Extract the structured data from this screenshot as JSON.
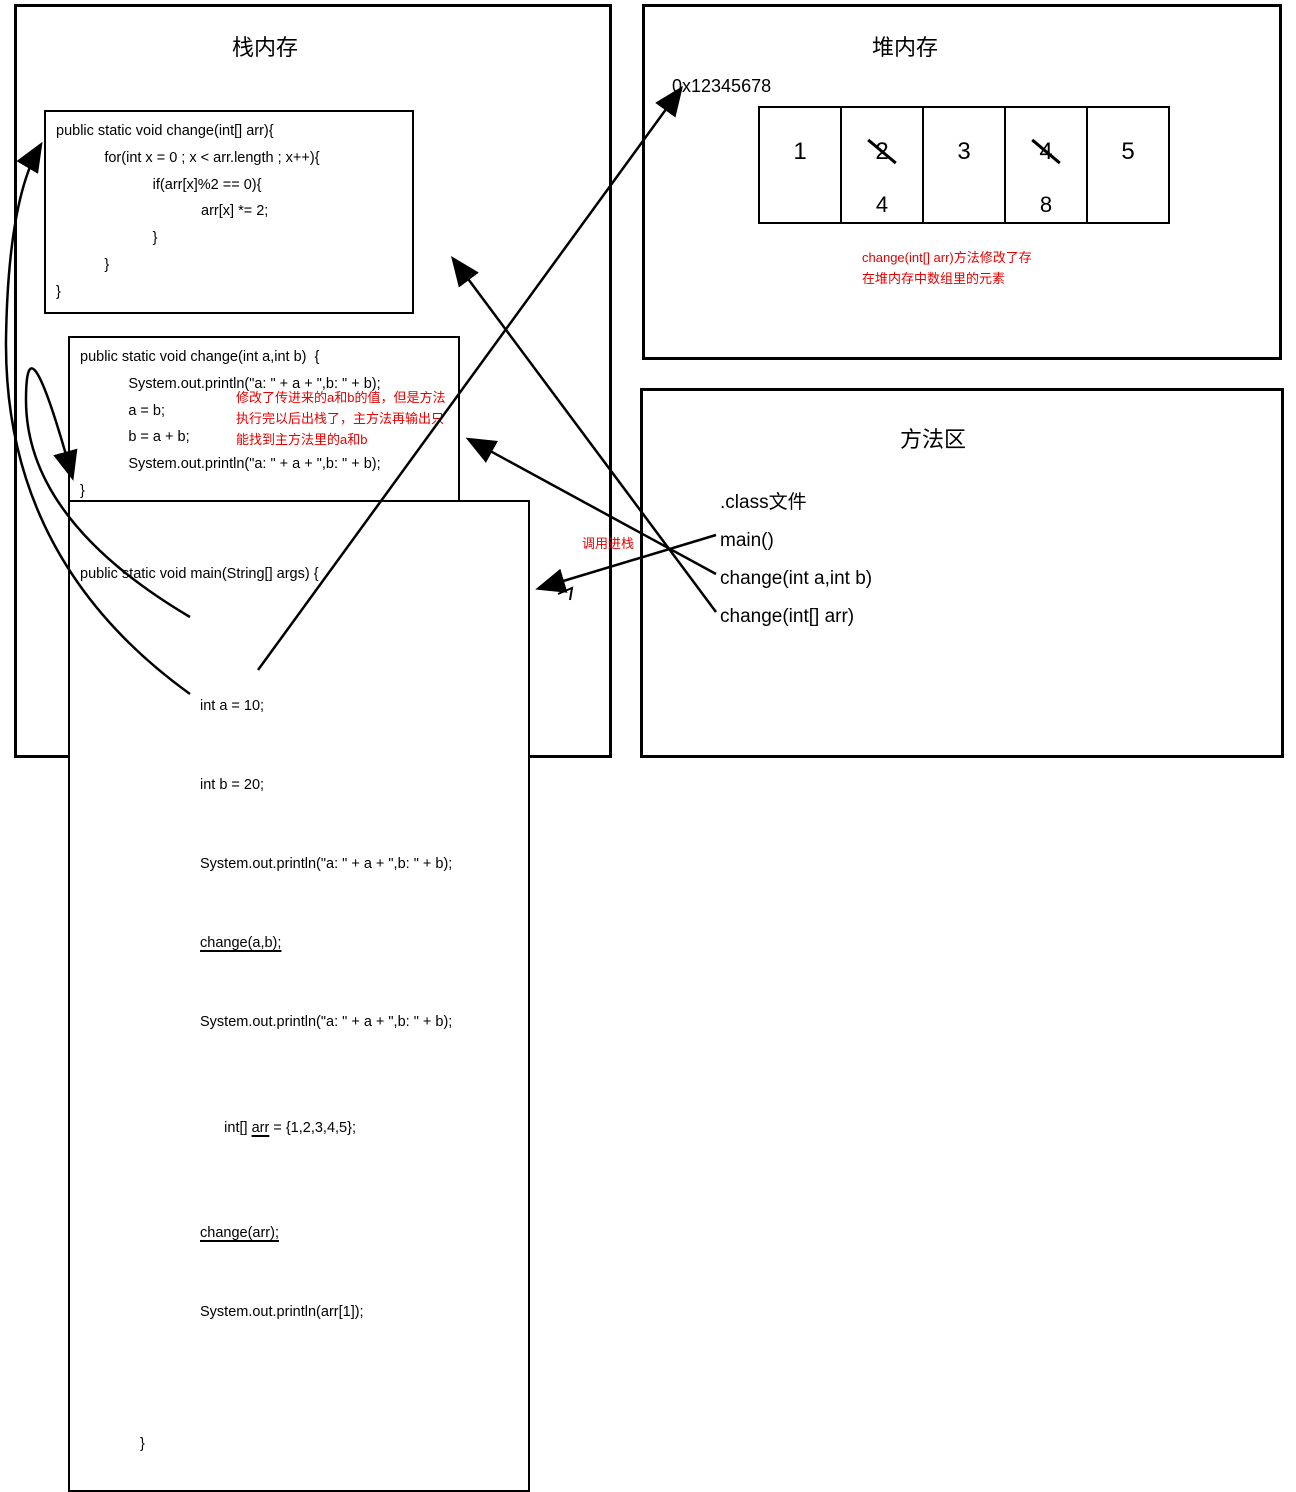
{
  "stack": {
    "title": "栈内存",
    "code1": "public static void change(int[] arr){\n            for(int x = 0 ; x < arr.length ; x++){\n                        if(arr[x]%2 == 0){\n                                    arr[x] *= 2;\n                        }\n            }\n}",
    "code2": "public static void change(int a,int b)  {\n            System.out.println(\"a: \" + a + \",b: \" + b);\n            a = b;\n            b = a + b;\n            System.out.println(\"a: \" + a + \",b: \" + b);\n}",
    "code3_sig": "public static void main(String[] args) {",
    "code3_l1": "int a = 10;",
    "code3_l2": "int b = 20;",
    "code3_l3": "System.out.println(\"a: \" + a + \",b: \" + b);",
    "code3_l4": "change(a,b);",
    "code3_l5": "System.out.println(\"a: \" + a + \",b: \" + b);",
    "code3_l6_pre": "int[] ",
    "code3_l6_u": "arr",
    "code3_l6_post": " = {1,2,3,4,5};",
    "code3_l7": "change(arr);",
    "code3_l8": "System.out.println(arr[1]);",
    "code3_close": "}",
    "note2": "修改了传进来的a和b的值，但是方法执行完以后出栈了，主方法再输出只能找到主方法里的a和b"
  },
  "heap": {
    "title": "堆内存",
    "addr": "0x12345678",
    "cells": [
      {
        "old": "1",
        "struck": false
      },
      {
        "old": "2",
        "struck": true,
        "new": "4"
      },
      {
        "old": "3",
        "struck": false
      },
      {
        "old": "4",
        "struck": true,
        "new": "8"
      },
      {
        "old": "5",
        "struck": false
      }
    ],
    "note": "change(int[] arr)方法修改了存在堆内存中数组里的元素"
  },
  "method_area": {
    "title": "方法区",
    "items": [
      ".class文件",
      "main()",
      "change(int a,int b)",
      "change(int[] arr)"
    ],
    "call_label": "调用进栈"
  }
}
